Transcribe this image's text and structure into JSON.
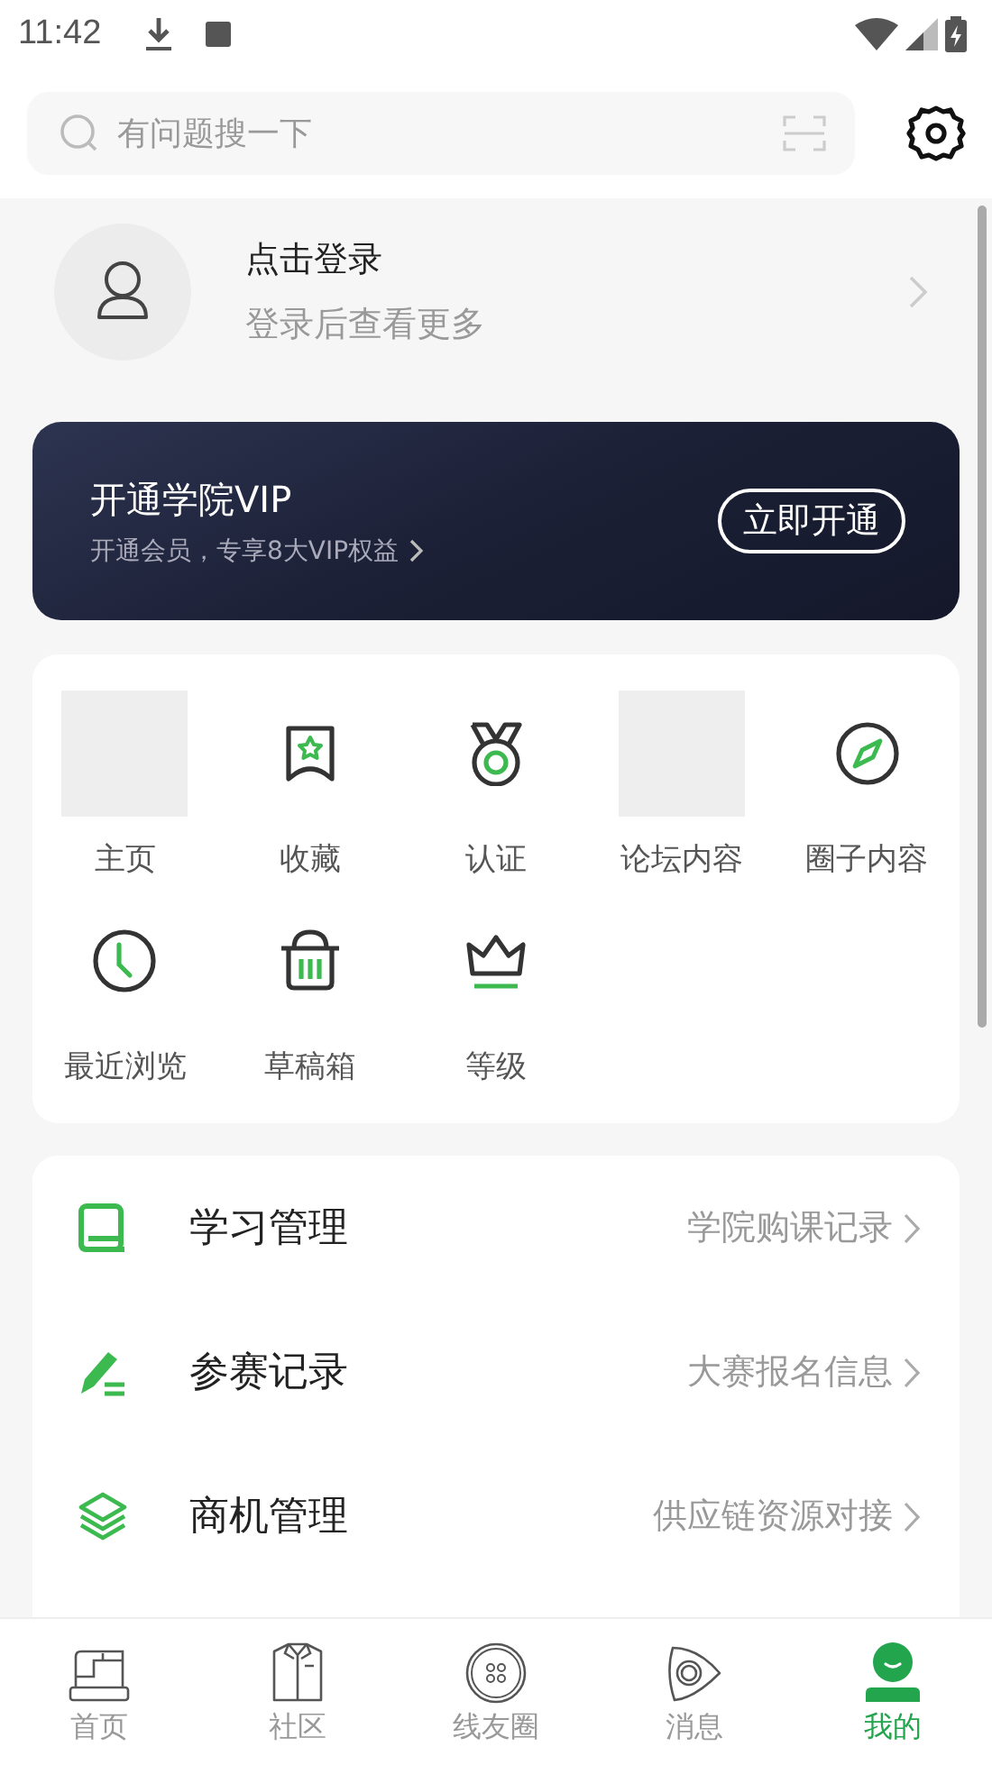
{
  "status_bar": {
    "time": "11:42"
  },
  "search": {
    "placeholder": "有问题搜一下"
  },
  "profile": {
    "title": "点击登录",
    "subtitle": "登录后查看更多"
  },
  "vip_banner": {
    "title": "开通学院VIP",
    "subtitle": "开通会员，专享8大VIP权益",
    "button": "立即开通"
  },
  "shortcuts": [
    {
      "label": "主页",
      "kind": "blank"
    },
    {
      "label": "收藏",
      "kind": "icon"
    },
    {
      "label": "认证",
      "kind": "icon"
    },
    {
      "label": "论坛内容",
      "kind": "blank"
    },
    {
      "label": "圈子内容",
      "kind": "icon"
    },
    {
      "label": "最近浏览",
      "kind": "icon"
    },
    {
      "label": "草稿箱",
      "kind": "icon"
    },
    {
      "label": "等级",
      "kind": "icon"
    }
  ],
  "menu": [
    {
      "label": "学习管理",
      "detail": "学院购课记录"
    },
    {
      "label": "参赛记录",
      "detail": "大赛报名信息"
    },
    {
      "label": "商机管理",
      "detail": "供应链资源对接"
    }
  ],
  "bottom_nav": [
    {
      "label": "首页",
      "selected": false
    },
    {
      "label": "社区",
      "selected": false
    },
    {
      "label": "线友圈",
      "selected": false
    },
    {
      "label": "消息",
      "selected": false
    },
    {
      "label": "我的",
      "selected": true
    }
  ]
}
